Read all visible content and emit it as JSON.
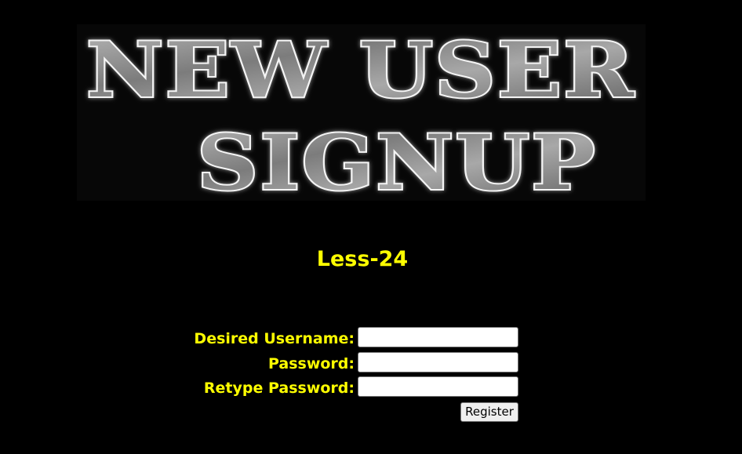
{
  "banner": {
    "line1": "NEW USER",
    "line2": "SIGNUP"
  },
  "lesson": {
    "title": "Less-24"
  },
  "form": {
    "username_label": "Desired Username:",
    "username_value": "",
    "password_label": "Password:",
    "password_value": "",
    "retype_label": "Retype Password:",
    "retype_value": "",
    "register_label": "Register"
  },
  "colors": {
    "background": "#000000",
    "accent_text": "#ffff00",
    "banner_fill": "#8a8a8a",
    "banner_outline": "#ffffff"
  }
}
